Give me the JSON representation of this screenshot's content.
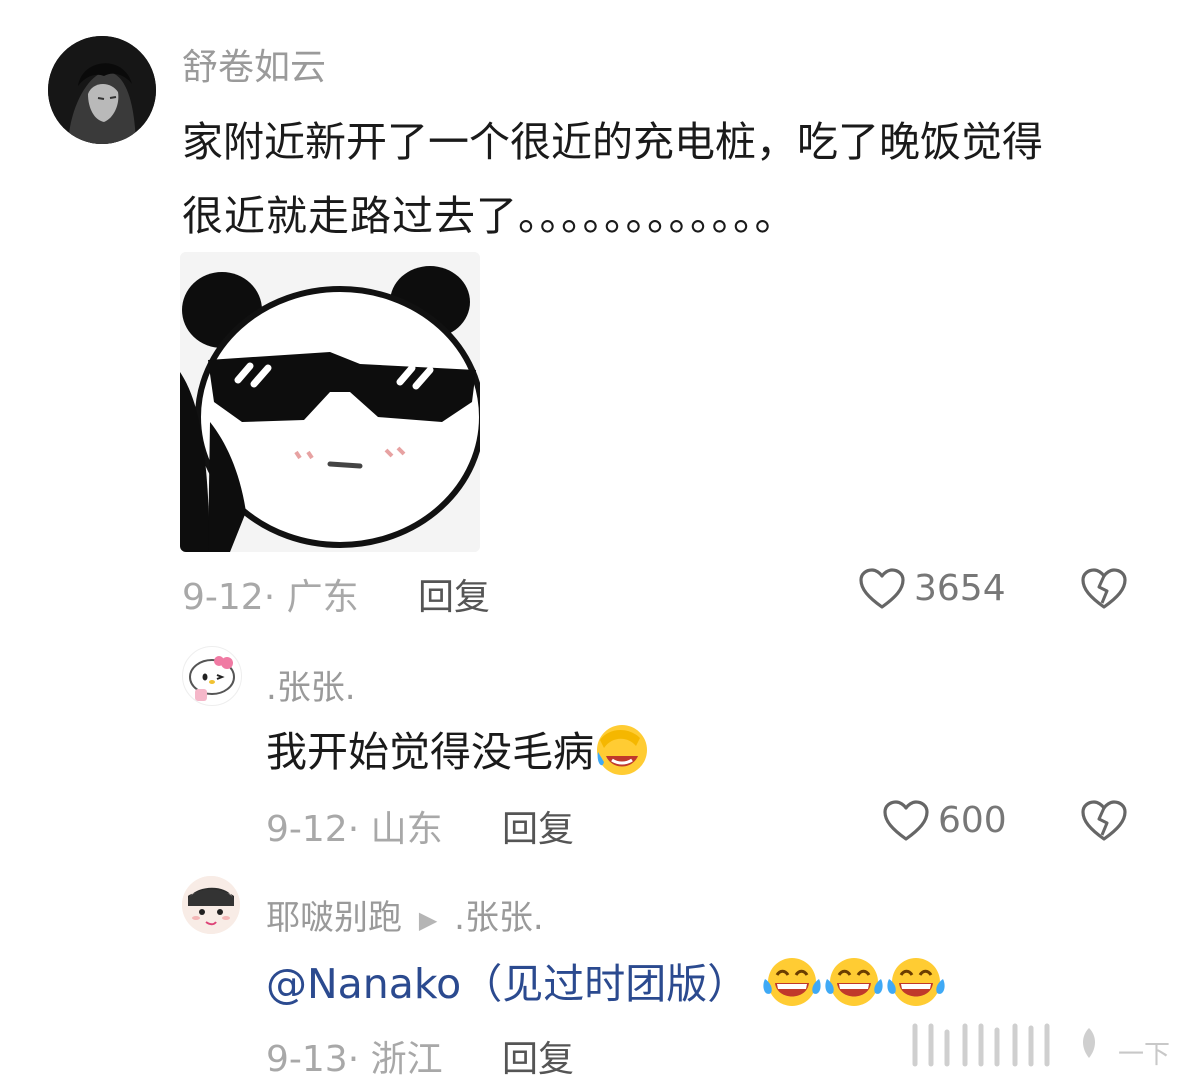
{
  "comment": {
    "username": "舒卷如云",
    "text_line1": "家附近新开了一个很近的充电桩，吃了晚饭觉得",
    "text_line2": "很近就走路过去了。。。。。。。。。。。。",
    "date_location": "9-12· 广东",
    "reply_label": "回复",
    "like_count": "3654",
    "sticker": "panda-sunglasses-sticker"
  },
  "reply1": {
    "username": ".张张.",
    "text": "我开始觉得没毛病",
    "emoji": "facepalm-laugh-emoji",
    "date_location": "9-12· 山东",
    "reply_label": "回复",
    "like_count": "600"
  },
  "reply2": {
    "username": "耶啵别跑",
    "reply_to": ".张张.",
    "mention": "@Nanako",
    "text": "（见过时团版）",
    "emojis": [
      "tears-of-joy-emoji",
      "tears-of-joy-emoji",
      "tears-of-joy-emoji"
    ],
    "date_location": "9-13· 浙江",
    "reply_label": "回复"
  },
  "watermark": "一下",
  "colors": {
    "mention": "#2b4a8f",
    "meta": "#a8a8a8",
    "username": "#9a9a9a"
  }
}
